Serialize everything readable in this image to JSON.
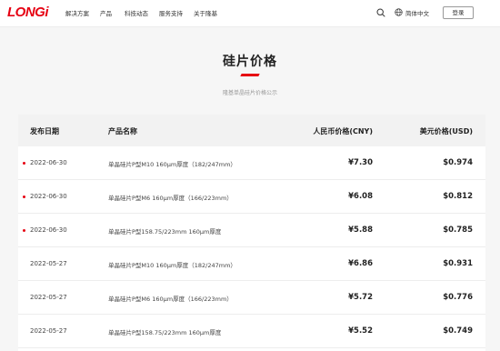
{
  "header": {
    "logo_text": "LONGi",
    "nav": [
      "解决方案",
      "产品",
      "科技动态",
      "服务支持",
      "关于隆基"
    ],
    "language_label": "简体中文",
    "login_label": "登录",
    "icons": {
      "search": "search-icon",
      "language": "globe-icon"
    }
  },
  "page": {
    "title": "硅片价格",
    "subtitle": "隆基单晶硅片价格公示"
  },
  "colors": {
    "brand": "#e60012",
    "header_bg": "#ffffff",
    "table_head_bg": "#f2f2f2"
  },
  "table": {
    "headers": {
      "date": "发布日期",
      "product": "产品名称",
      "cny": "人民币价格(CNY)",
      "usd": "美元价格(USD)"
    },
    "rows": [
      {
        "date": "2022-06-30",
        "product": "单晶硅片P型M10 160μm厚度（182/247mm）",
        "cny": "¥7.30",
        "usd": "$0.974",
        "new": true
      },
      {
        "date": "2022-06-30",
        "product": "单晶硅片P型M6 160μm厚度（166/223mm）",
        "cny": "¥6.08",
        "usd": "$0.812",
        "new": true
      },
      {
        "date": "2022-06-30",
        "product": "单晶硅片P型158.75/223mm 160μm厚度",
        "cny": "¥5.88",
        "usd": "$0.785",
        "new": true
      },
      {
        "date": "2022-05-27",
        "product": "单晶硅片P型M10 160μm厚度（182/247mm）",
        "cny": "¥6.86",
        "usd": "$0.931",
        "new": false
      },
      {
        "date": "2022-05-27",
        "product": "单晶硅片P型M6 160μm厚度（166/223mm）",
        "cny": "¥5.72",
        "usd": "$0.776",
        "new": false
      },
      {
        "date": "2022-05-27",
        "product": "单晶硅片P型158.75/223mm 160μm厚度",
        "cny": "¥5.52",
        "usd": "$0.749",
        "new": false
      }
    ]
  }
}
